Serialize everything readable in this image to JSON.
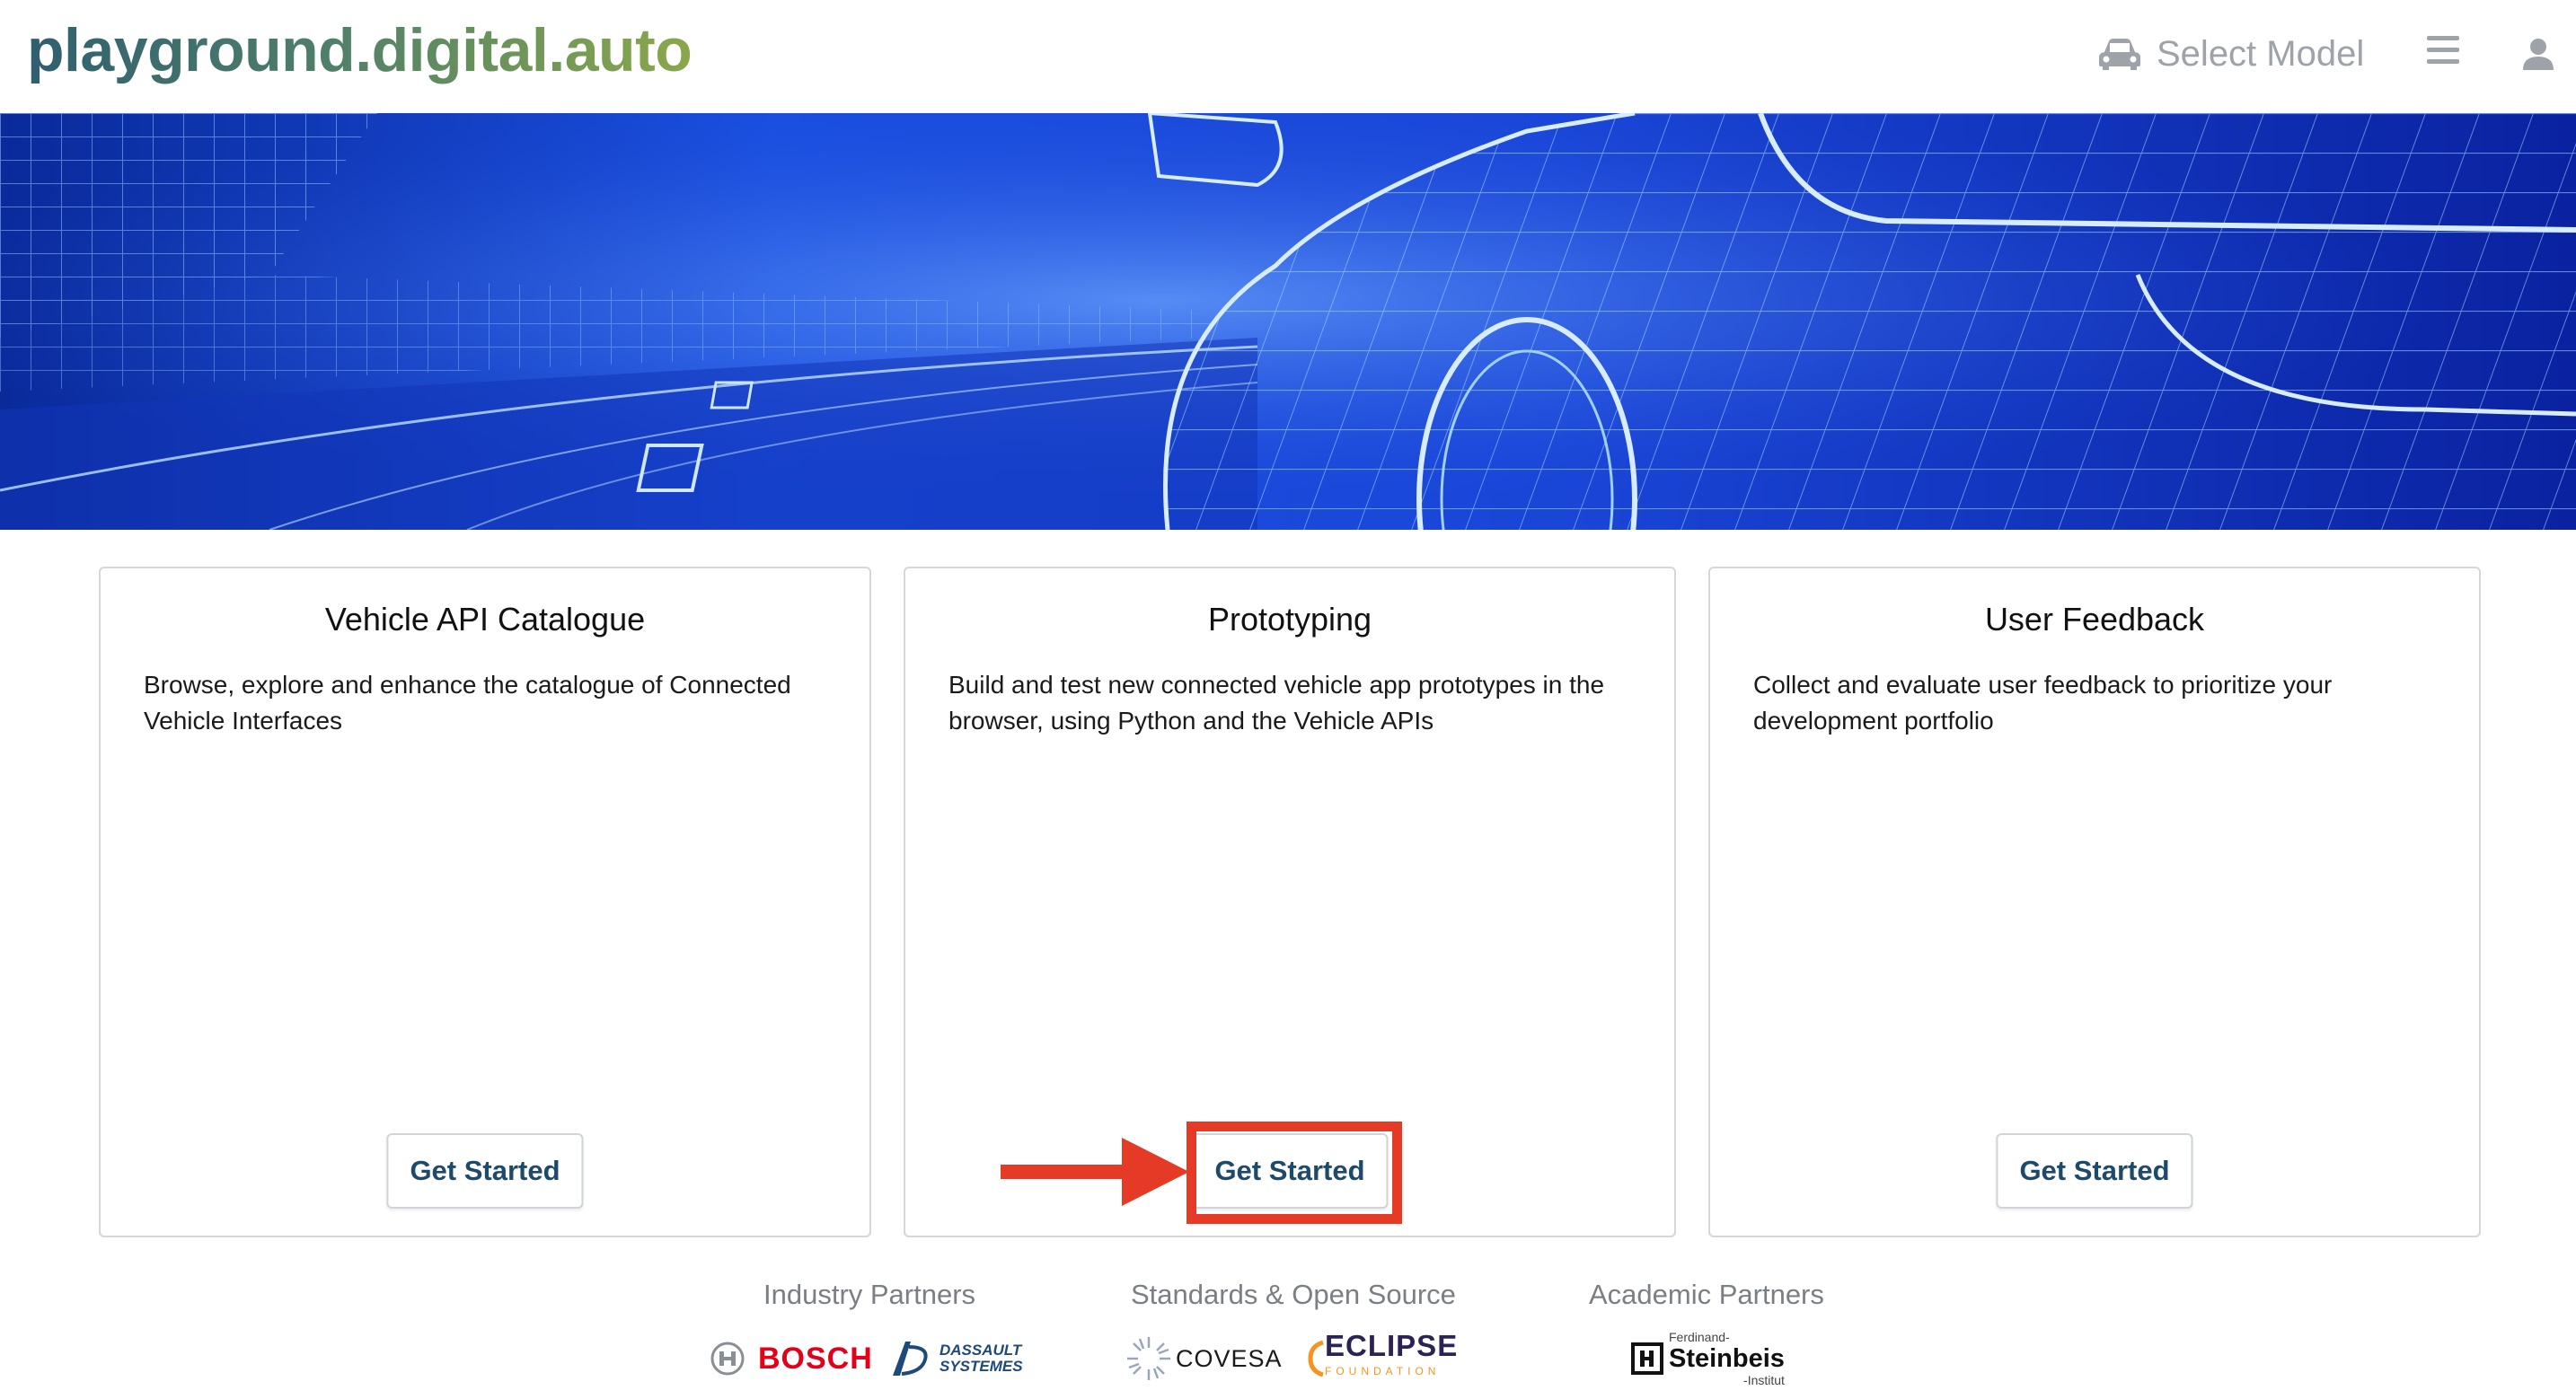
{
  "header": {
    "brand": "playground.digital.auto",
    "select_model_label": "Select Model",
    "icons": [
      "car-icon",
      "menu-icon",
      "user-icon"
    ]
  },
  "hero": {
    "description": ""
  },
  "cards": [
    {
      "title": "Vehicle API Catalogue",
      "description": "Browse, explore and enhance the catalogue of Connected Vehicle Interfaces",
      "button": "Get Started"
    },
    {
      "title": "Prototyping",
      "description": "Build and test new connected vehicle app prototypes in the browser, using Python and the Vehicle APIs",
      "button": "Get Started"
    },
    {
      "title": "User Feedback",
      "description": "Collect and evaluate user feedback to prioritize your development portfolio",
      "button": "Get Started"
    }
  ],
  "partners": {
    "industry_title": "Industry Partners",
    "standards_title": "Standards & Open Source",
    "academic_title": "Academic Partners",
    "logos": {
      "bosch": "BOSCH",
      "dassault_line1": "DASSAULT",
      "dassault_line2": "SYSTEMES",
      "covesa": "COVESA",
      "eclipse": "ECLIPSE",
      "eclipse_sub": "FOUNDATION",
      "steinbeis_top": "Ferdinand-",
      "steinbeis_main": "Steinbeis",
      "steinbeis_sub": "-Institut"
    }
  },
  "colors": {
    "brand_start": "#2f5f6f",
    "brand_end": "#8aa84a",
    "button_text": "#1d4a6b",
    "highlight": "#e53b26",
    "bosch_red": "#e2001a",
    "eclipse_orange": "#f7941e",
    "hero_blue": "#1540d8"
  }
}
